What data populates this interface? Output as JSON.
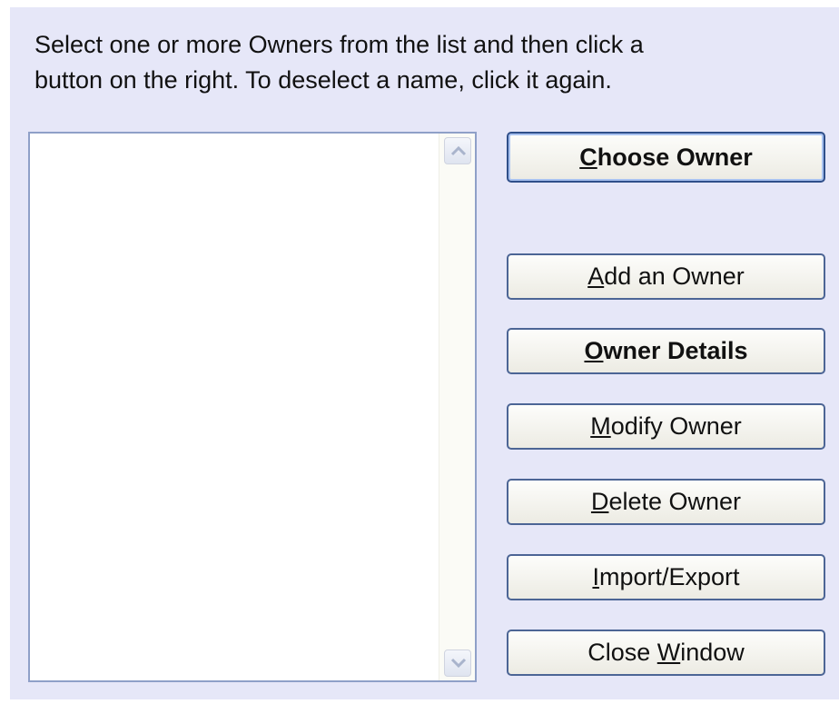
{
  "instructions": "Select one or more Owners from the list and then click a\nbutton on the right. To deselect a name, click it again.",
  "owners_list": {
    "items": []
  },
  "buttons": {
    "choose_owner": {
      "accel": "C",
      "rest": "hoose Owner"
    },
    "add_owner": {
      "accel": "A",
      "rest": "dd an Owner"
    },
    "owner_details": {
      "accel": "O",
      "rest": "wner Details"
    },
    "modify_owner": {
      "accel": "M",
      "rest": "odify Owner"
    },
    "delete_owner": {
      "accel": "D",
      "rest": "elete Owner"
    },
    "import_export": {
      "accel": "I",
      "rest": "mport/Export"
    },
    "close_window": {
      "pre": "Close ",
      "accel": "W",
      "rest": "indow"
    }
  },
  "icons": {
    "scroll_up": "chevron-up-icon",
    "scroll_down": "chevron-down-icon"
  },
  "colors": {
    "panel_background": "#e6e7f8",
    "button_border": "#4c6595"
  }
}
